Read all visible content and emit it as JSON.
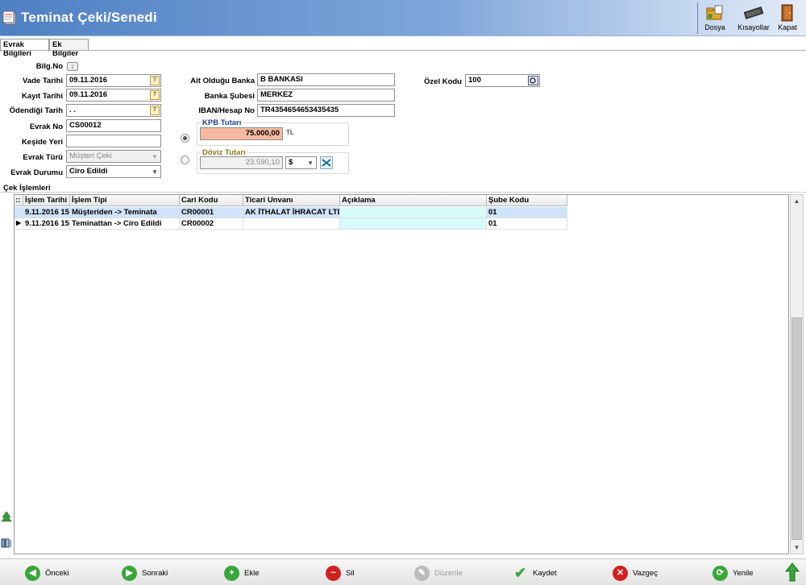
{
  "window": {
    "title": "Teminat Çeki/Senedi",
    "toolbar": [
      {
        "label": "Dosya",
        "icon": "folder-icon"
      },
      {
        "label": "Kısayollar",
        "icon": "keyboard-icon"
      },
      {
        "label": "Kapat",
        "icon": "door-exit-icon"
      }
    ]
  },
  "tabs": [
    {
      "label": "Evrak Bilgileri",
      "active": true
    },
    {
      "label": "Ek Bilgiler",
      "active": false
    }
  ],
  "form": {
    "bilg_no_label": "Bilg.No",
    "vade_tarihi_label": "Vade Tarihi",
    "vade_tarihi_value": "09.11.2016",
    "kayit_tarihi_label": "Kayıt Tarihi",
    "kayit_tarihi_value": "09.11.2016",
    "odendigi_tarih_label": "Ödendiği Tarih",
    "odendigi_tarih_value": " .  .",
    "evrak_no_label": "Evrak No",
    "evrak_no_value": "CS00012",
    "keside_yeri_label": "Keşide Yeri",
    "keside_yeri_value": "",
    "evrak_turu_label": "Evrak Türü",
    "evrak_turu_value": "Müşteri Çeki",
    "evrak_durumu_label": "Evrak Durumu",
    "evrak_durumu_value": "Ciro Edildi",
    "ait_banka_label": "Ait Olduğu Banka",
    "ait_banka_value": "B BANKASI",
    "banka_subesi_label": "Banka Şubesi",
    "banka_subesi_value": "MERKEZ",
    "iban_label": "IBAN/Hesap No",
    "iban_value": "TR4354654653435435",
    "ozel_kodu_label": "Özel Kodu",
    "ozel_kodu_value": "100",
    "kpb_title": "KPB Tutarı",
    "kpb_value": "75.000,00",
    "kpb_currency": "TL",
    "doviz_title": "Döviz Tutarı",
    "doviz_value": "23.590,10",
    "doviz_currency": "$"
  },
  "section": {
    "title": "Çek İşlemleri"
  },
  "grid": {
    "corner": "::",
    "columns": [
      "İşlem Tarihi",
      "İşlem Tipi",
      "Cari Kodu",
      "Ticari Unvanı",
      "Açıklama",
      "Şube Kodu"
    ],
    "rows": [
      [
        "9.11.2016 15",
        "Müşteriden -> Teminata",
        "CR00001",
        "AK İTHALAT İHRACAT LTD",
        "",
        "01"
      ],
      [
        "9.11.2016 15",
        "Teminattan -> Ciro Edildi",
        "CR00002",
        "",
        "",
        "01"
      ]
    ]
  },
  "bottom": {
    "buttons": [
      {
        "label": "Önceki",
        "icon": "arrow-left-icon",
        "color": "#3aa63a"
      },
      {
        "label": "Sonraki",
        "icon": "arrow-right-icon",
        "color": "#3aa63a"
      },
      {
        "label": "Ekle",
        "icon": "plus-icon",
        "color": "#3aa63a"
      },
      {
        "label": "Sil",
        "icon": "minus-icon",
        "color": "#d12020"
      },
      {
        "label": "Düzenle",
        "icon": "edit-icon",
        "color": "#bbbbbb"
      },
      {
        "label": "Kaydet",
        "icon": "check-icon",
        "color": "#3aa63a"
      },
      {
        "label": "Vazgeç",
        "icon": "cancel-icon",
        "color": "#d12020"
      },
      {
        "label": "Yenile",
        "icon": "refresh-icon",
        "color": "#3aa63a"
      }
    ]
  }
}
